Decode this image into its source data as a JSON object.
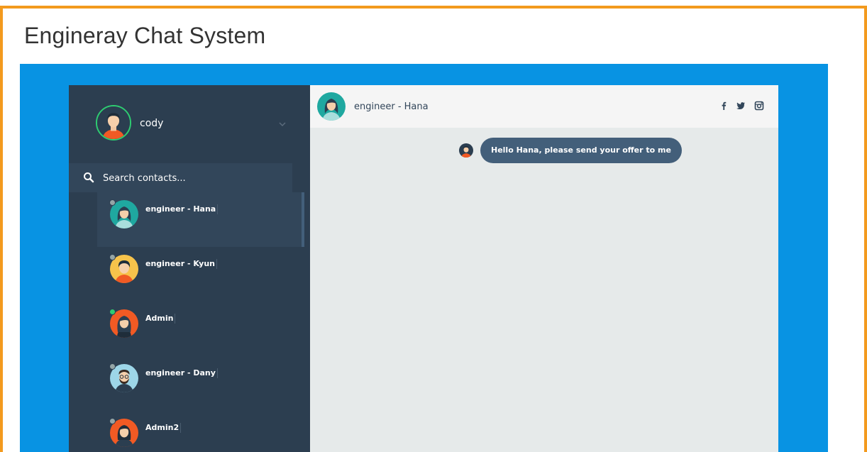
{
  "page": {
    "title": "Engineray Chat System"
  },
  "user": {
    "name": "cody",
    "status_color": "#2ecc71"
  },
  "search": {
    "placeholder": "Search contacts..."
  },
  "contacts": [
    {
      "name": "engineer - Hana",
      "status": "away",
      "status_color": "#95a5a6",
      "active": true
    },
    {
      "name": "engineer - Kyun",
      "status": "away",
      "status_color": "#95a5a6",
      "active": false
    },
    {
      "name": "Admin",
      "status": "online",
      "status_color": "#2ecc71",
      "active": false
    },
    {
      "name": "engineer - Dany",
      "status": "away",
      "status_color": "#95a5a6",
      "active": false
    },
    {
      "name": "Admin2",
      "status": "away",
      "status_color": "#95a5a6",
      "active": false
    }
  ],
  "chat": {
    "header": {
      "title": "engineer - Hana"
    },
    "social_icons": [
      "facebook-icon",
      "twitter-icon",
      "instagram-icon"
    ],
    "messages": [
      {
        "from": "cody",
        "text": "Hello Hana, please send your offer to me"
      }
    ]
  },
  "colors": {
    "frame_border": "#f39a1e",
    "background_blue": "#0893e3",
    "sidebar": "#2c3e50",
    "sidebar_active": "#32465a",
    "chat_background": "#e6eaea",
    "bubble": "#435f7a"
  }
}
